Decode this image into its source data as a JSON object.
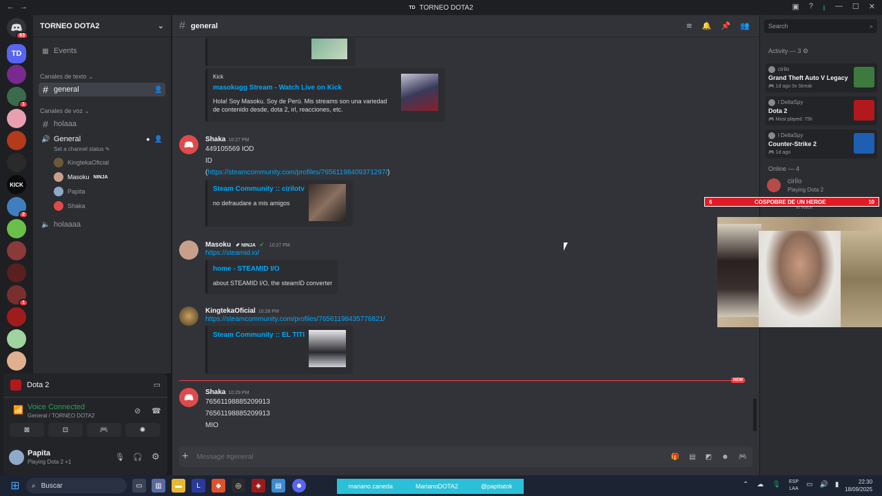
{
  "titlebar": {
    "title": "TORNEO DOTA2",
    "logo": "TD"
  },
  "servers": {
    "home_badge": "63",
    "items": [
      {
        "label": "TD",
        "color": "#5865f2",
        "badge": ""
      },
      {
        "label": "",
        "color": "#7a2a8e",
        "badge": ""
      },
      {
        "label": "",
        "color": "#3b6b4b",
        "badge": "1"
      },
      {
        "label": "",
        "color": "#e8a0b0",
        "badge": ""
      },
      {
        "label": "",
        "color": "#b33a1a",
        "badge": ""
      },
      {
        "label": "",
        "color": "#2a2a2a",
        "badge": ""
      },
      {
        "label": "KICK",
        "color": "#0b0b0b",
        "badge": ""
      },
      {
        "label": "",
        "color": "#3f7fbf",
        "badge": "2"
      },
      {
        "label": "",
        "color": "#6abf4b",
        "badge": ""
      },
      {
        "label": "",
        "color": "#8b3a3a",
        "badge": ""
      },
      {
        "label": "",
        "color": "#5a1f1f",
        "badge": ""
      },
      {
        "label": "",
        "color": "#7a2f2f",
        "badge": "1"
      },
      {
        "label": "",
        "color": "#a01c1c",
        "badge": ""
      },
      {
        "label": "",
        "color": "#9fd39f",
        "badge": ""
      },
      {
        "label": "",
        "color": "#e0b090",
        "badge": ""
      }
    ]
  },
  "sidebar": {
    "server_name": "TORNEO DOTA2",
    "events": "Events",
    "text_category": "Canales de texto",
    "text_channel": "general",
    "voice_category": "Canales de voz",
    "voice_channel_1": "holaaa",
    "voice_channel_2": "General",
    "channel_status": "Set a channel status",
    "voice_users": [
      {
        "name": "KingtekaOficial",
        "color": "#6b5a3a"
      },
      {
        "name": "Masoku",
        "color": "#c8a08a",
        "tag": "NINJA"
      },
      {
        "name": "Papita",
        "color": "#8fa9c8"
      },
      {
        "name": "Shaka",
        "color": "#e04a4a"
      }
    ],
    "voice_channel_3": "holaaaa"
  },
  "userpanel": {
    "activity": "Dota 2",
    "voice_status": "Voice Connected",
    "voice_location": "General / TORNEO DOTA2",
    "username": "Papita",
    "user_activity": "Playing Dota 2 +1"
  },
  "main": {
    "channel": "general",
    "messages": {
      "kick_embed": {
        "provider": "Kick",
        "title": "masokugg Stream - Watch Live on Kick",
        "desc": "Hola! Soy Masoku. Soy de Perú. Mis streams son una variedad de contenido desde, dota 2, irl, reacciones, etc."
      },
      "m1": {
        "user": "Shaka",
        "time": "10:27 PM",
        "line1": "449105569 IOD",
        "line2": "ID",
        "line3_open": "(",
        "line3_link": "https://steamcommunity.com/profiles/76561198409371297/",
        "line3_close": ")",
        "embed_title": "Steam Community :: cirilotv",
        "embed_desc": "no defraudare a mis amigos"
      },
      "m2": {
        "user": "Masoku",
        "tag": "NINJA",
        "time": "10:27 PM",
        "link": "https://steamid.io/",
        "embed_title": "home - STEAMID I/O",
        "embed_desc": "about STEAMID I/O, the steamID converter"
      },
      "m3": {
        "user": "KingtekaOficial",
        "time": "10:28 PM",
        "link": "https://steamcommunity.com/profiles/76561198435776821/",
        "embed_title": "Steam Community :: EL TITI"
      },
      "new_label": "NEW",
      "m4": {
        "user": "Shaka",
        "time": "10:29 PM",
        "line1": "76561198885209913",
        "line2": "76561198885209913",
        "line3": "MIO"
      }
    },
    "input_placeholder": "Message #general"
  },
  "search": {
    "placeholder": "Search"
  },
  "members": {
    "activity_header": "Activity — 3",
    "activities": [
      {
        "user": "cirilo",
        "game": "Grand Theft Auto V Legacy",
        "meta1": "1d ago",
        "meta2": "3x Streak",
        "color": "#3d7a3d"
      },
      {
        "user": "l DeltaSpy",
        "game": "Dota 2",
        "meta1": "Most played: 75h",
        "meta2": "",
        "color": "#b3191c"
      },
      {
        "user": "l DeltaSpy",
        "game": "Counter-Strike 2",
        "meta1": "1d ago",
        "meta2": "",
        "color": "#1e5fb3"
      }
    ],
    "online_header": "Online — 4",
    "online": [
      {
        "name": "cirilo",
        "status": "Playing Dota 2"
      },
      {
        "name": "",
        "status": "In voice"
      }
    ]
  },
  "overlay": {
    "left": "6",
    "title": "COSPOBRE DE UN HEROE",
    "right": "10"
  },
  "taskbar": {
    "search": "Buscar",
    "tags": [
      "mariano.caneda",
      "MarianoDOTA2",
      "@papitatok"
    ],
    "lang1": "ESP",
    "lang2": "LAA",
    "time": "22:30",
    "date": "18/09/2025"
  }
}
